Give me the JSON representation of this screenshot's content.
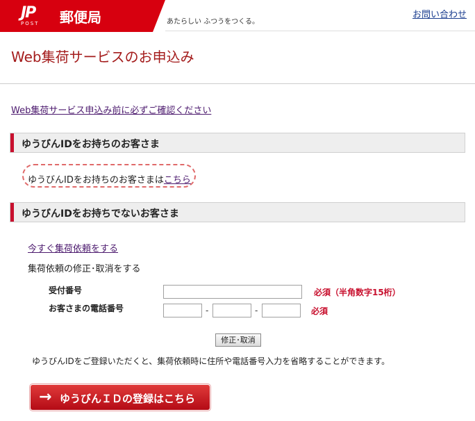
{
  "header": {
    "logo_mark": "JP",
    "logo_post": "POST",
    "logo_text": "郵便局",
    "tagline": "あたらしい ふつうをつくる。",
    "contact_link": "お問い合わせ"
  },
  "page_title": "Web集荷サービスのお申込み",
  "confirm_link": "Web集荷サービス申込み前に必ずご確認ください",
  "section_has_id": {
    "heading": "ゆうびんIDをお持ちのお客さま",
    "text": "ゆうびんIDをお持ちのお客さまは",
    "link": "こちら"
  },
  "section_no_id": {
    "heading": "ゆうびんIDをお持ちでないお客さま",
    "request_link": "今すぐ集荷依頼をする",
    "modify_label": "集荷依頼の修正･取消をする",
    "receipt_label": "受付番号",
    "receipt_value": "",
    "receipt_required": "必須（半角数字15桁）",
    "phone_label": "お客さまの電話番号",
    "phone_part1": "",
    "phone_part2": "",
    "phone_part3": "",
    "phone_separator": "-",
    "phone_required": "必須",
    "modify_button": "修正･取消",
    "info_text": "ゆうびんIDをご登録いただくと、集荷依頼時に住所や電話番号入力を省略することができます。",
    "register_button": "ゆうびんＩＤの登録はこちら"
  },
  "colors": {
    "brand_red": "#d7000f",
    "title_red": "#a41c1c",
    "link_purple": "#4c1a6e"
  }
}
